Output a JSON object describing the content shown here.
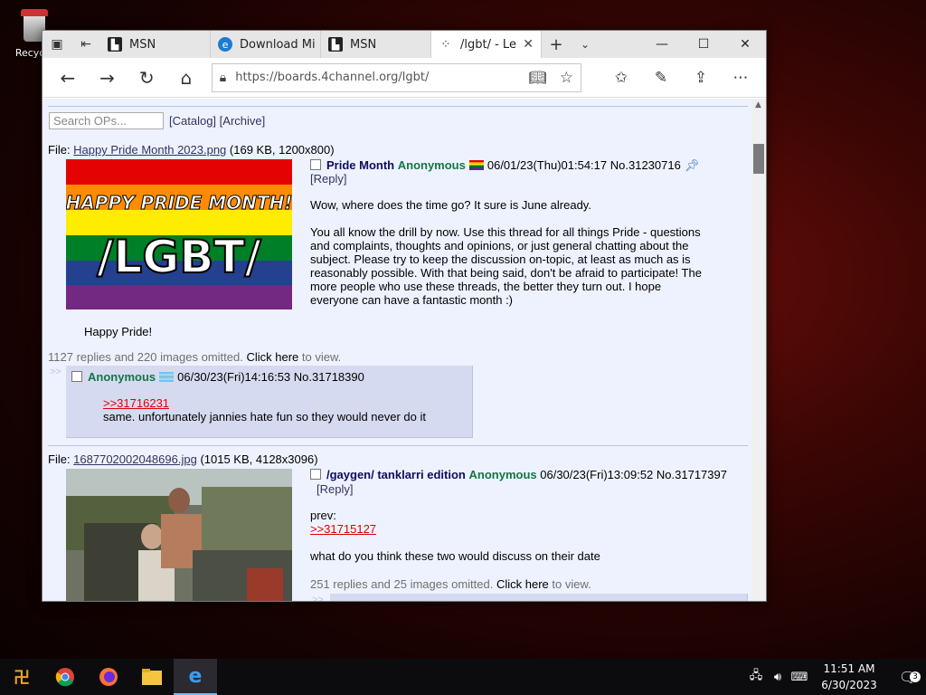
{
  "desktop": {
    "recycle_label": "Recycle"
  },
  "browser": {
    "tabs": [
      {
        "label": "MSN",
        "icon": "msn-icon"
      },
      {
        "label": "Download Mi",
        "icon": "edge-icon"
      },
      {
        "label": "MSN",
        "icon": "msn-icon"
      },
      {
        "label": "/lgbt/ - Le",
        "icon": "4chan-icon",
        "active": true
      }
    ],
    "url": "https://boards.4channel.org/lgbt/"
  },
  "page": {
    "search_placeholder": "Search OPs...",
    "catalog_link": "[Catalog]",
    "archive_link": "[Archive]",
    "threads": [
      {
        "file_prefix": "File: ",
        "file_name": "Happy Pride Month 2023.png",
        "file_meta": "(169 KB, 1200x800)",
        "image_text_top": "HAPPY PRIDE MONTH!",
        "image_text_big": "/LGBT/",
        "subject": "Pride Month",
        "name": "Anonymous",
        "datetime": "06/01/23(Thu)01:54:17",
        "number": "No.31230716",
        "reply_label": "[Reply]",
        "paragraphs": [
          "Wow, where does the time go? It sure is June already.",
          "You all know the drill by now. Use this thread for all things Pride - questions and complaints, thoughts and opinions, or just general chatting about the subject. Please try to keep the discussion on-topic, at least as much as is reasonably possible. With that being said, don't be afraid to participate! The more people who use these threads, the better they turn out. I hope everyone can have a fantastic month :)"
        ],
        "caption": "Happy Pride!",
        "omitted_text": "1127 replies and 220 images omitted.",
        "omitted_link": "Click here",
        "omitted_suffix": "to view.",
        "reply": {
          "name": "Anonymous",
          "datetime": "06/30/23(Fri)14:16:53",
          "number": "No.31718390",
          "quote": ">>31716231",
          "text": "same. unfortunately jannies hate fun so they would never do it"
        }
      },
      {
        "file_prefix": "File: ",
        "file_name": "1687702002048696.jpg",
        "file_meta": "(1015 KB, 4128x3096)",
        "subject": "/gaygen/ tanklarri edition",
        "name": "Anonymous",
        "datetime": "06/30/23(Fri)13:09:52",
        "number": "No.31717397",
        "reply_label": "[Reply]",
        "prev_label": "prev:",
        "quote": ">>31715127",
        "text": "what do you think these two would discuss on their date",
        "omitted_text": "251 replies and 25 images omitted.",
        "omitted_link": "Click here",
        "omitted_suffix": "to view."
      }
    ]
  },
  "taskbar": {
    "time": "11:51 AM",
    "date": "6/30/2023",
    "notification_count": "3"
  },
  "colors": {
    "board_bg": "#eef2ff",
    "reply_bg": "#d6daf0",
    "name_green": "#117743",
    "subject_blue": "#0f0c5d",
    "quote_red": "#dd0000"
  }
}
